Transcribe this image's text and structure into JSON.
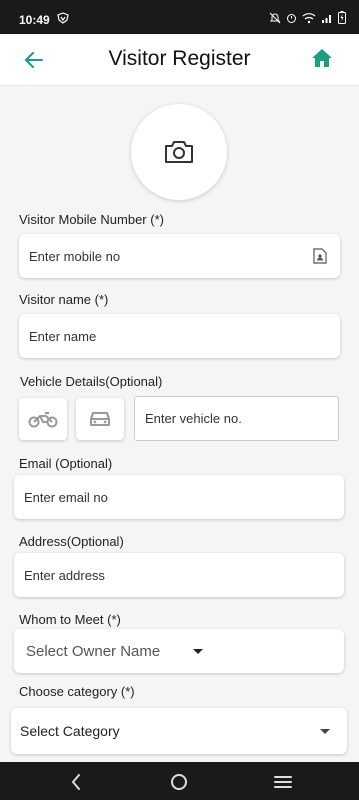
{
  "status": {
    "time": "10:49",
    "battery": "battery-charging-icon"
  },
  "appbar": {
    "title": "Visitor Register",
    "back_icon": "arrow-left-icon",
    "home_icon": "home-icon",
    "accent": "#1a9e84"
  },
  "photo": {
    "icon": "camera-icon"
  },
  "form": {
    "mobile": {
      "label": "Visitor Mobile Number (*)",
      "placeholder": "Enter mobile no",
      "icon": "contact-card-icon"
    },
    "name": {
      "label": "Visitor name (*)",
      "placeholder": "Enter name"
    },
    "vehicle": {
      "label": "Vehicle Details(Optional)",
      "placeholder": "Enter vehicle no.",
      "bike_icon": "motorcycle-icon",
      "car_icon": "car-icon"
    },
    "email": {
      "label": "Email (Optional)",
      "placeholder": "Enter email no"
    },
    "address": {
      "label": "Address(Optional)",
      "placeholder": "Enter address"
    },
    "meet": {
      "label": "Whom to Meet (*)",
      "selected": "Select Owner Name"
    },
    "category": {
      "label": "Choose category (*)",
      "selected": "Select Category"
    }
  },
  "navbar": {
    "back": "nav-back-icon",
    "home": "nav-home-icon",
    "menu": "nav-menu-icon"
  }
}
